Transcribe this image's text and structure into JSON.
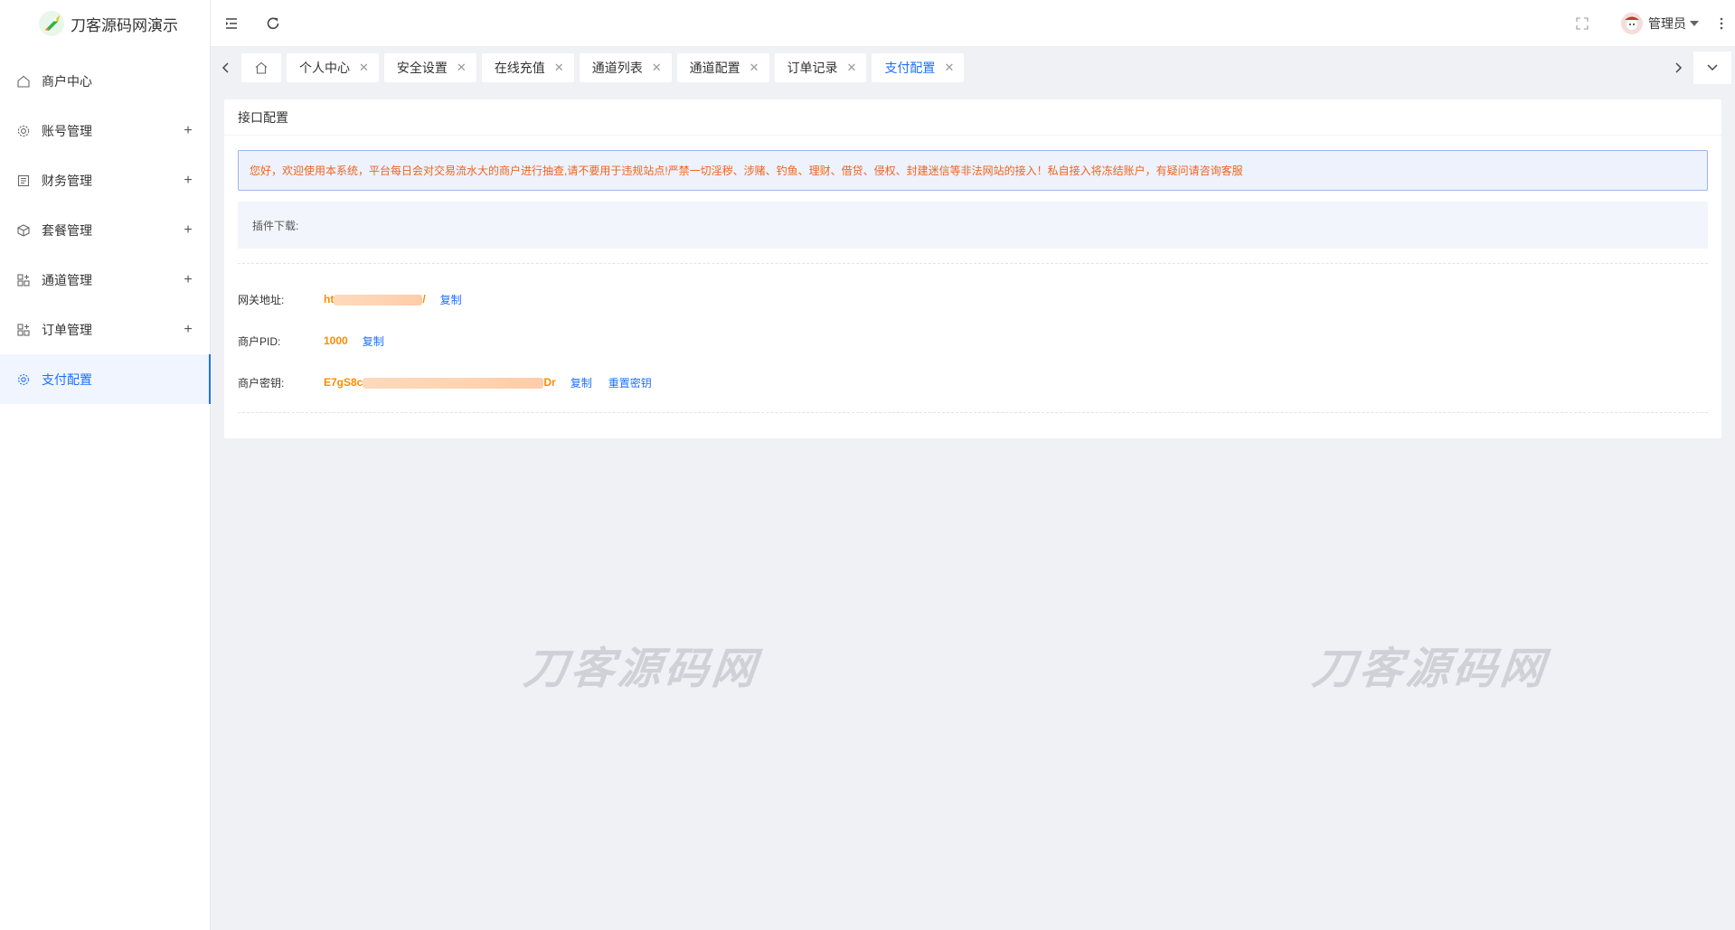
{
  "app": {
    "title": "刀客源码网演示"
  },
  "sidebar": {
    "items": [
      {
        "label": "商户中心",
        "icon": "home-icon",
        "expandable": false,
        "active": false
      },
      {
        "label": "账号管理",
        "icon": "gear-icon",
        "expandable": true,
        "active": false
      },
      {
        "label": "财务管理",
        "icon": "ledger-icon",
        "expandable": true,
        "active": false
      },
      {
        "label": "套餐管理",
        "icon": "box-icon",
        "expandable": true,
        "active": false
      },
      {
        "label": "通道管理",
        "icon": "apps-icon",
        "expandable": true,
        "active": false
      },
      {
        "label": "订单管理",
        "icon": "apps-icon",
        "expandable": true,
        "active": false
      },
      {
        "label": "支付配置",
        "icon": "settings-icon",
        "expandable": false,
        "active": true
      }
    ],
    "plus": "+"
  },
  "header": {
    "user": {
      "name": "管理员"
    }
  },
  "tabs": {
    "items": [
      {
        "label": "个人中心",
        "active": false
      },
      {
        "label": "安全设置",
        "active": false
      },
      {
        "label": "在线充值",
        "active": false
      },
      {
        "label": "通道列表",
        "active": false
      },
      {
        "label": "通道配置",
        "active": false
      },
      {
        "label": "订单记录",
        "active": false
      },
      {
        "label": "支付配置",
        "active": true
      }
    ],
    "close_glyph": "✕"
  },
  "card": {
    "title": "接口配置",
    "notice": "您好，欢迎使用本系统，平台每日会对交易流水大的商户进行抽查,请不要用于违规站点!严禁一切淫秽、涉赌、钓鱼、理财、借贷、侵权、封建迷信等非法网站的接入！私自接入将冻结账户，有疑问请咨询客服",
    "plugin_label": "插件下载:",
    "fields": {
      "gateway": {
        "label": "网关地址:",
        "value_prefix": "ht",
        "value_suffix": "/",
        "copy": "复制"
      },
      "pid": {
        "label": "商户PID:",
        "value": "1000",
        "copy": "复制"
      },
      "key": {
        "label": "商户密钥:",
        "value_prefix": "E7gS8c",
        "value_suffix": "Dr",
        "copy": "复制",
        "reset": "重置密钥"
      }
    }
  },
  "watermark": {
    "text": "刀客源码网"
  },
  "colors": {
    "accent": "#1e6fff",
    "warning": "#f0641e",
    "value": "#ff8a00"
  }
}
